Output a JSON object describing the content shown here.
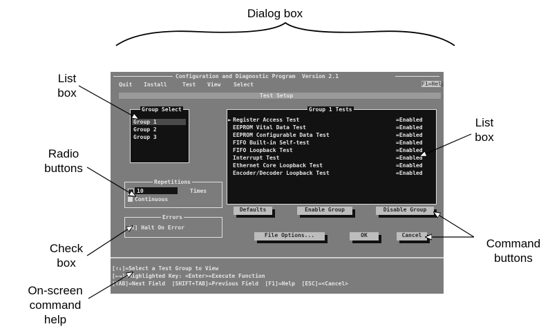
{
  "callouts": {
    "dialog_box": "Dialog box",
    "list_box_left": [
      "List",
      "box"
    ],
    "radio_buttons": [
      "Radio",
      "buttons"
    ],
    "check_box": [
      "Check",
      "box"
    ],
    "onscreen_help": [
      "On-screen",
      "command",
      "help"
    ],
    "list_box_right": [
      "List",
      "box"
    ],
    "command_buttons": [
      "Command",
      "buttons"
    ]
  },
  "screen": {
    "title": "Configuration and Diagnostic Program  Version 2.1",
    "menu": [
      "Quit",
      "Install",
      "Test",
      "View",
      "Select"
    ],
    "help_label": "F1=Help",
    "setup_title": "Test Setup",
    "group_select": {
      "title": "Group Select",
      "items": [
        "Group 1",
        "Group 2",
        "Group 3"
      ]
    },
    "tests": {
      "title": "Group 1 Tests",
      "rows": [
        {
          "name": "Register Access Test",
          "status": "=Enabled"
        },
        {
          "name": "EEPROM Vital Data Test",
          "status": "=Enabled"
        },
        {
          "name": "EEPROM Configurable Data Test",
          "status": "=Enabled"
        },
        {
          "name": "FIFO Built-in Self-test",
          "status": "=Enabled"
        },
        {
          "name": "FIFO Loopback Test",
          "status": "=Enabled"
        },
        {
          "name": "Interrupt Test",
          "status": "=Enabled"
        },
        {
          "name": "Ethernet Core Loopback Test",
          "status": "=Enabled"
        },
        {
          "name": "Encoder/Decoder Loopback Test",
          "status": "=Enabled"
        }
      ]
    },
    "repetitions": {
      "title": "Repetitions",
      "value": "10",
      "times_label": "Times",
      "continuous_label": "Continuous"
    },
    "errors": {
      "title": "Errors",
      "halt_label": "[X] Halt On Error"
    },
    "buttons": {
      "defaults": "Defaults",
      "enable_group": "Enable Group",
      "disable_group": "Disable Group",
      "file_options": "File Options...",
      "ok": "OK",
      "cancel": "Cancel"
    },
    "status_lines": [
      "[↑↓]=Select a Test Group to View",
      "[←→]=Highlighted Key: <Enter>=Execute Function",
      "[TAB]=Next Field  [SHIFT+TAB]=Previous Field  [F1]=Help  [ESC]=<Cancel>"
    ]
  }
}
